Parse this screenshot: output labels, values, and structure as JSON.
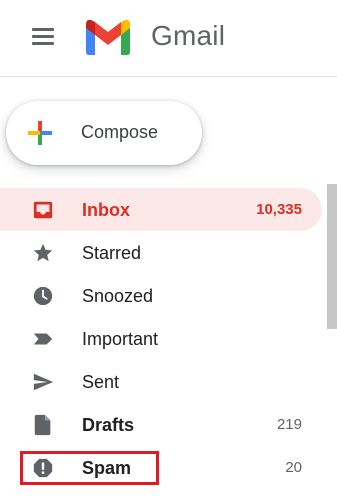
{
  "app": {
    "name": "Gmail"
  },
  "compose": {
    "label": "Compose"
  },
  "nav": {
    "items": [
      {
        "label": "Inbox",
        "count": "10,335",
        "icon": "inbox-icon"
      },
      {
        "label": "Starred",
        "count": "",
        "icon": "star-icon"
      },
      {
        "label": "Snoozed",
        "count": "",
        "icon": "clock-icon"
      },
      {
        "label": "Important",
        "count": "",
        "icon": "important-icon"
      },
      {
        "label": "Sent",
        "count": "",
        "icon": "send-icon"
      },
      {
        "label": "Drafts",
        "count": "219",
        "icon": "draft-icon"
      },
      {
        "label": "Spam",
        "count": "20",
        "icon": "spam-icon"
      }
    ]
  },
  "colors": {
    "accent_red": "#d93025",
    "active_bg": "#fce8e6",
    "highlight_border": "#e01b24"
  }
}
